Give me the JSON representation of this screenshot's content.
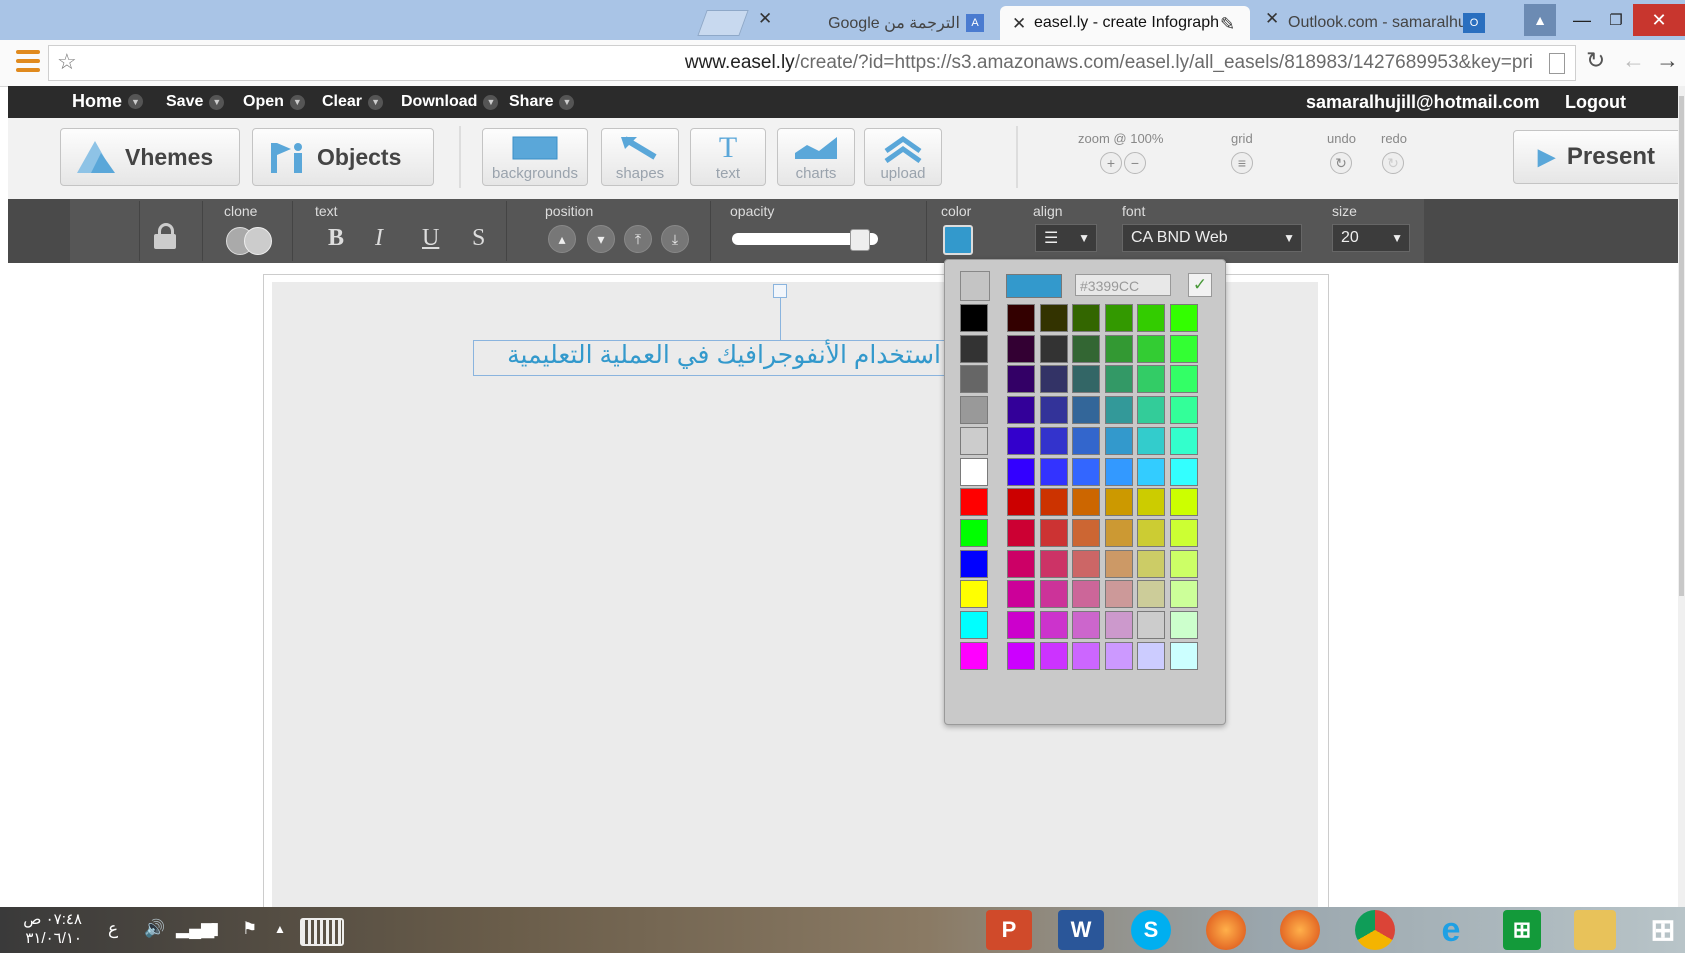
{
  "browser": {
    "tabs": [
      {
        "title": "الترجمة من Google"
      },
      {
        "title": "easel.ly - create Infograph"
      },
      {
        "title": "Outlook.com - samaralhuj"
      }
    ],
    "close_glyph": "✕",
    "url_host": "www.easel.ly",
    "url_path": "/create/?id=https://s3.amazonaws.com/easel.ly/all_easels/818983/1427689953&key=pri"
  },
  "menu": {
    "items": [
      {
        "label": "Home"
      },
      {
        "label": "Save"
      },
      {
        "label": "Open"
      },
      {
        "label": "Clear"
      },
      {
        "label": "Download"
      },
      {
        "label": "Share"
      }
    ],
    "user_email": "samaralhujill@hotmail.com",
    "logout_label": "Logout"
  },
  "toolbar": {
    "vhemes_label": "Vhemes",
    "objects_label": "Objects",
    "tools": [
      {
        "label": "backgrounds",
        "icon": "rectangle-icon"
      },
      {
        "label": "shapes",
        "icon": "arrow-icon"
      },
      {
        "label": "text",
        "icon": "text-t-icon",
        "glyph": "T"
      },
      {
        "label": "charts",
        "icon": "chart-icon"
      },
      {
        "label": "upload",
        "icon": "upload-icon"
      }
    ],
    "zoom_label": "zoom @ 100%",
    "grid_label": "grid",
    "undo_label": "undo",
    "redo_label": "redo",
    "present_label": "Present"
  },
  "format": {
    "clone_label": "clone",
    "text_label": "text",
    "bold": "B",
    "italic": "I",
    "underline": "U",
    "strike": "S",
    "position_label": "position",
    "opacity_label": "opacity",
    "opacity_value": 0.92,
    "color_label": "color",
    "align_label": "align",
    "font_label": "font",
    "font_value": "CA BND Web",
    "size_label": "size",
    "size_value": "20"
  },
  "canvas": {
    "title_text": "استخدام الأنفوجرافيك في العملية التعليمية"
  },
  "picker": {
    "current_color": "#3399CC",
    "hex_placeholder": "#3399CC",
    "ok_glyph": "✓",
    "grays": [
      "#000000",
      "#333333",
      "#666666",
      "#999999",
      "#cccccc",
      "#ffffff",
      "#ff0000",
      "#00ff00",
      "#0000ff",
      "#ffff00",
      "#00ffff",
      "#ff00ff"
    ],
    "grid": [
      [
        "#330000",
        "#333300",
        "#336600",
        "#339900",
        "#33cc00",
        "#33ff00"
      ],
      [
        "#330033",
        "#333333",
        "#336633",
        "#339933",
        "#33cc33",
        "#33ff33"
      ],
      [
        "#330066",
        "#333366",
        "#336666",
        "#339966",
        "#33cc66",
        "#33ff66"
      ],
      [
        "#330099",
        "#333399",
        "#336699",
        "#339999",
        "#33cc99",
        "#33ff99"
      ],
      [
        "#3300cc",
        "#3333cc",
        "#3366cc",
        "#3399cc",
        "#33cccc",
        "#33ffcc"
      ],
      [
        "#3300ff",
        "#3333ff",
        "#3366ff",
        "#3399ff",
        "#33ccff",
        "#33ffff"
      ],
      [
        "#cc0000",
        "#cc3300",
        "#cc6600",
        "#cc9900",
        "#cccc00",
        "#ccff00"
      ],
      [
        "#cc0033",
        "#cc3333",
        "#cc6633",
        "#cc9933",
        "#cccc33",
        "#ccff33"
      ],
      [
        "#cc0066",
        "#cc3366",
        "#cc6666",
        "#cc9966",
        "#cccc66",
        "#ccff66"
      ],
      [
        "#cc0099",
        "#cc3399",
        "#cc6699",
        "#cc9999",
        "#cccc99",
        "#ccff99"
      ],
      [
        "#cc00cc",
        "#cc33cc",
        "#cc66cc",
        "#cc99cc",
        "#cccccc",
        "#ccffcc"
      ],
      [
        "#cc00ff",
        "#cc33ff",
        "#cc66ff",
        "#cc99ff",
        "#ccccff",
        "#ccffff"
      ]
    ]
  },
  "taskbar": {
    "time": "٠٧:٤٨ ص",
    "date": "٣١/٠٦/١٠",
    "lang": "ع",
    "apps": [
      "powerpoint-icon",
      "word-icon",
      "skype-icon",
      "firefox-icon",
      "firefox-icon",
      "chrome-icon",
      "ie-icon",
      "store-icon",
      "explorer-icon",
      "start-icon"
    ]
  }
}
